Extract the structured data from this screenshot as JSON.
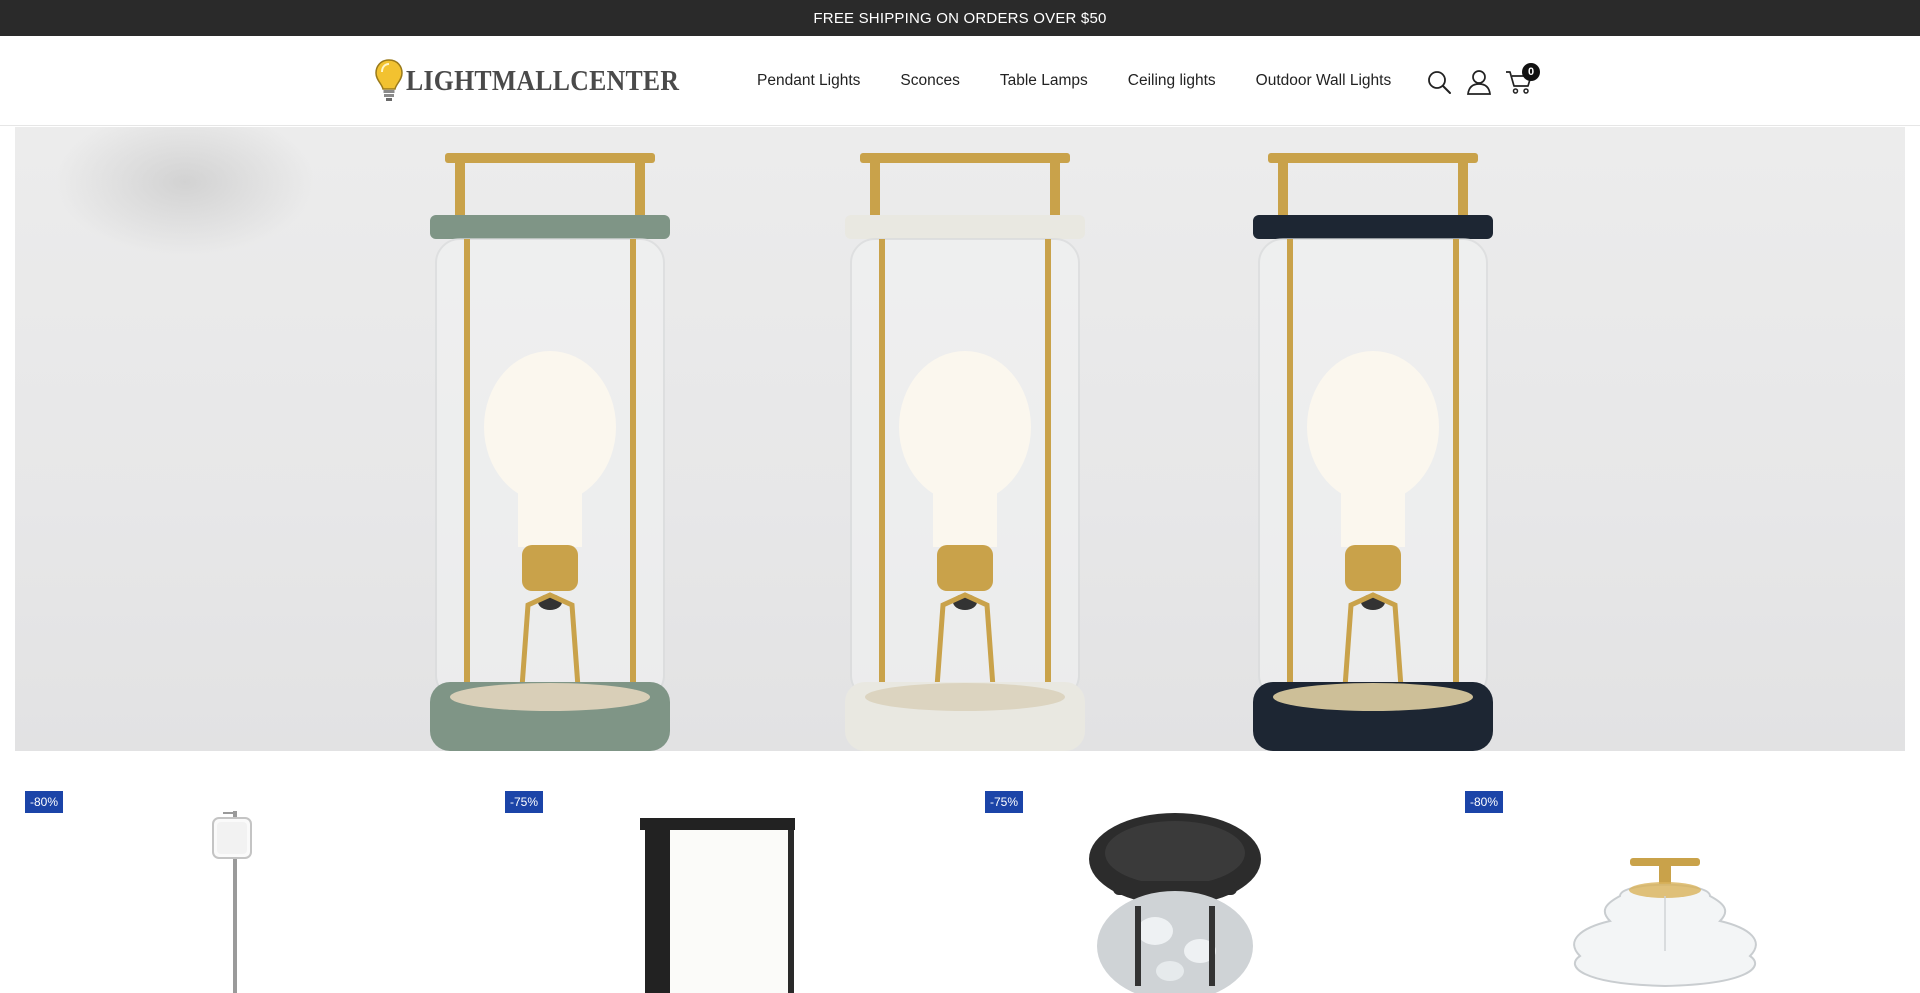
{
  "announcement": {
    "text": "FREE SHIPPING ON ORDERS OVER $50"
  },
  "header": {
    "logo_text": "LIGHTMALLCENTER",
    "nav": [
      {
        "label": "Pendant Lights"
      },
      {
        "label": "Sconces"
      },
      {
        "label": "Table Lamps"
      },
      {
        "label": "Ceiling lights"
      },
      {
        "label": "Outdoor Wall Lights"
      }
    ],
    "icons": [
      "search-icon",
      "account-icon",
      "cart-icon"
    ],
    "cart_count": "0"
  },
  "hero": {
    "image": "three-cylindrical-glass-lanterns-with-bulbs",
    "lantern_colors": [
      "#7f9586",
      "#e9e8e1",
      "#1d2633"
    ]
  },
  "products": [
    {
      "badge": "-80%",
      "image": "floor-lamp-thin"
    },
    {
      "badge": "-75%",
      "image": "outdoor-wall-sconce-black"
    },
    {
      "badge": "-75%",
      "image": "flush-mount-seeded-glass-black"
    },
    {
      "badge": "-80%",
      "image": "flush-mount-clear-glass-brass"
    }
  ],
  "colors": {
    "topbar": "#2a2a2a",
    "badge": "#1b44a8",
    "brass": "#c9a24a"
  }
}
